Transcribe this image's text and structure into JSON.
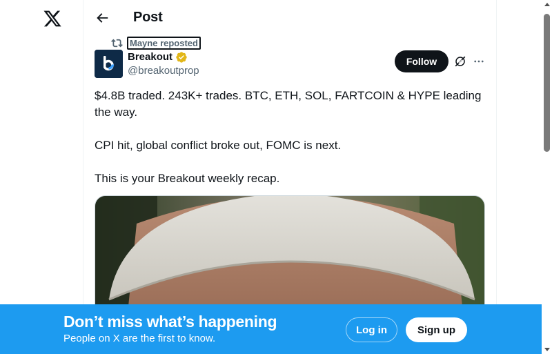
{
  "brand": {
    "logo_icon": "x-logo-icon"
  },
  "header": {
    "back_icon": "arrow-left-icon",
    "title": "Post"
  },
  "repost": {
    "icon": "repost-icon",
    "label": "Mayne reposted"
  },
  "author": {
    "display_name": "Breakout",
    "handle": "@breakoutprop",
    "verified_color": "#e2b719",
    "avatar_bg": "#0e2a47"
  },
  "actions": {
    "follow_label": "Follow",
    "grok_icon": "grok-icon",
    "more_icon": "more-horizontal-icon"
  },
  "post": {
    "paragraphs": [
      "$4.8B traded. 243K+ trades. BTC, ETH, SOL, FARTCOIN & HYPE leading the way.",
      "CPI hit, global conflict broke out, FOMC is next.",
      "This is your Breakout weekly recap."
    ],
    "media_description": "photo"
  },
  "banner": {
    "title": "Don’t miss what’s happening",
    "subtitle": "People on X are the first to know.",
    "login_label": "Log in",
    "signup_label": "Sign up",
    "bg_color": "#1d9bf0"
  }
}
